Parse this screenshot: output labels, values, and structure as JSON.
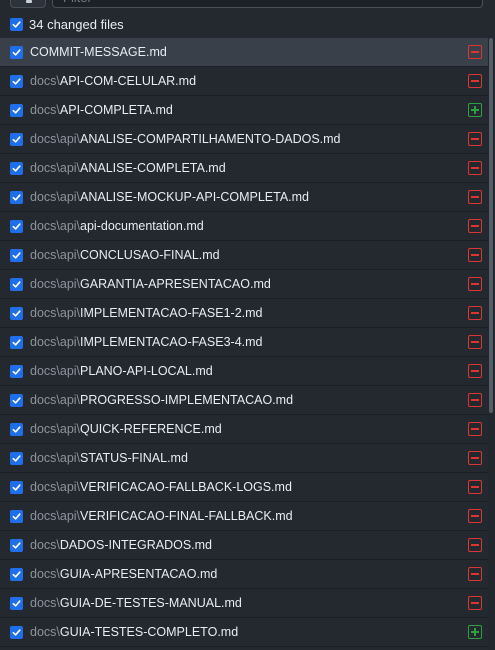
{
  "filter": {
    "placeholder": "Filter"
  },
  "header": {
    "changed_label": "34 changed files",
    "checked": true
  },
  "files": [
    {
      "dir": "",
      "name": "COMMIT-MESSAGE.md",
      "status": "deleted",
      "checked": true
    },
    {
      "dir": "docs\\",
      "name": "API-COM-CELULAR.md",
      "status": "deleted",
      "checked": true
    },
    {
      "dir": "docs\\",
      "name": "API-COMPLETA.md",
      "status": "added",
      "checked": true
    },
    {
      "dir": "docs\\api\\",
      "name": "ANALISE-COMPARTILHAMENTO-DADOS.md",
      "status": "deleted",
      "checked": true
    },
    {
      "dir": "docs\\api\\",
      "name": "ANALISE-COMPLETA.md",
      "status": "deleted",
      "checked": true
    },
    {
      "dir": "docs\\api\\",
      "name": "ANALISE-MOCKUP-API-COMPLETA.md",
      "status": "deleted",
      "checked": true
    },
    {
      "dir": "docs\\api\\",
      "name": "api-documentation.md",
      "status": "deleted",
      "checked": true
    },
    {
      "dir": "docs\\api\\",
      "name": "CONCLUSAO-FINAL.md",
      "status": "deleted",
      "checked": true
    },
    {
      "dir": "docs\\api\\",
      "name": "GARANTIA-APRESENTACAO.md",
      "status": "deleted",
      "checked": true
    },
    {
      "dir": "docs\\api\\",
      "name": "IMPLEMENTACAO-FASE1-2.md",
      "status": "deleted",
      "checked": true
    },
    {
      "dir": "docs\\api\\",
      "name": "IMPLEMENTACAO-FASE3-4.md",
      "status": "deleted",
      "checked": true
    },
    {
      "dir": "docs\\api\\",
      "name": "PLANO-API-LOCAL.md",
      "status": "deleted",
      "checked": true
    },
    {
      "dir": "docs\\api\\",
      "name": "PROGRESSO-IMPLEMENTACAO.md",
      "status": "deleted",
      "checked": true
    },
    {
      "dir": "docs\\api\\",
      "name": "QUICK-REFERENCE.md",
      "status": "deleted",
      "checked": true
    },
    {
      "dir": "docs\\api\\",
      "name": "STATUS-FINAL.md",
      "status": "deleted",
      "checked": true
    },
    {
      "dir": "docs\\api\\",
      "name": "VERIFICACAO-FALLBACK-LOGS.md",
      "status": "deleted",
      "checked": true
    },
    {
      "dir": "docs\\api\\",
      "name": "VERIFICACAO-FINAL-FALLBACK.md",
      "status": "deleted",
      "checked": true
    },
    {
      "dir": "docs\\",
      "name": "DADOS-INTEGRADOS.md",
      "status": "deleted",
      "checked": true
    },
    {
      "dir": "docs\\",
      "name": "GUIA-APRESENTACAO.md",
      "status": "deleted",
      "checked": true
    },
    {
      "dir": "docs\\",
      "name": "GUIA-DE-TESTES-MANUAL.md",
      "status": "deleted",
      "checked": true
    },
    {
      "dir": "docs\\",
      "name": "GUIA-TESTES-COMPLETO.md",
      "status": "added",
      "checked": true
    }
  ],
  "colors": {
    "accent": "#1f6feb",
    "deleted": "#da3633",
    "added": "#2ea043"
  },
  "icons": {
    "sort": "sort-icon",
    "deleted": "file-deleted-icon",
    "added": "file-added-icon",
    "checkbox": "checkmark-icon"
  }
}
